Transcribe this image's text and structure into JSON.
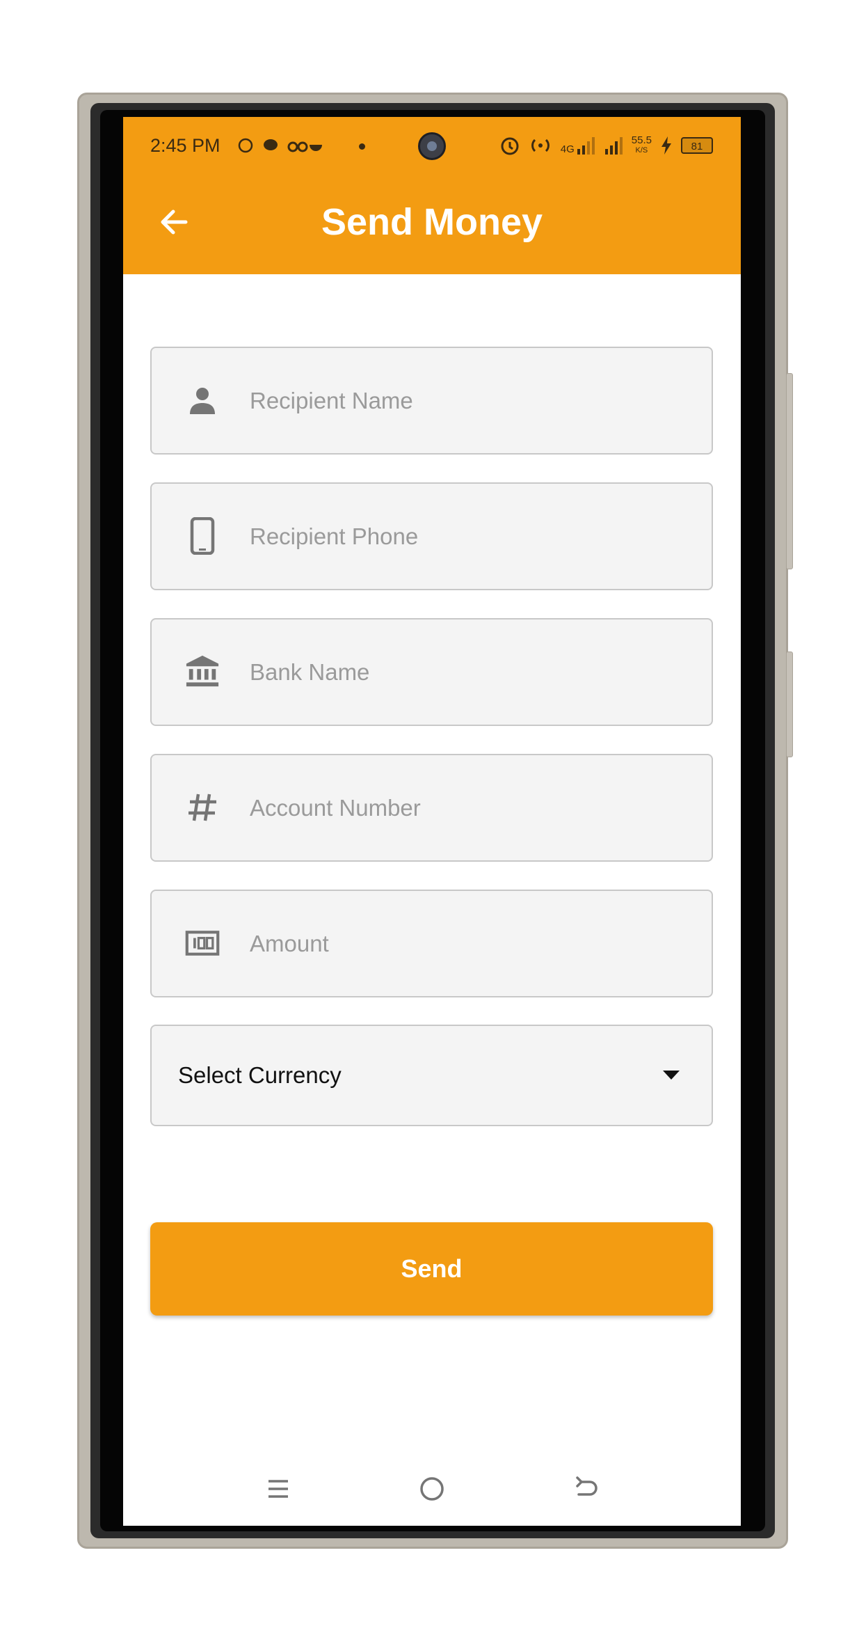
{
  "status_bar": {
    "time": "2:45 PM",
    "network": "4G",
    "speed": "55.5",
    "speed_unit": "K/S",
    "battery": "81"
  },
  "header": {
    "title": "Send Money",
    "back_icon": "arrow-left-icon"
  },
  "form": {
    "fields": [
      {
        "icon": "person-icon",
        "placeholder": "Recipient Name",
        "value": ""
      },
      {
        "icon": "phone-icon",
        "placeholder": "Recipient Phone",
        "value": ""
      },
      {
        "icon": "bank-icon",
        "placeholder": "Bank Name",
        "value": ""
      },
      {
        "icon": "hash-icon",
        "placeholder": "Account Number",
        "value": ""
      },
      {
        "icon": "money-icon",
        "placeholder": "Amount",
        "value": ""
      }
    ],
    "currency_select": {
      "label": "Select Currency",
      "icon": "dropdown-arrow-icon"
    },
    "send_label": "Send"
  },
  "navigation": {
    "items": [
      "menu-icon",
      "home-icon",
      "back-icon"
    ]
  },
  "colors": {
    "accent": "#f39c12",
    "field_bg": "#f4f4f4",
    "icon_gray": "#757575"
  }
}
